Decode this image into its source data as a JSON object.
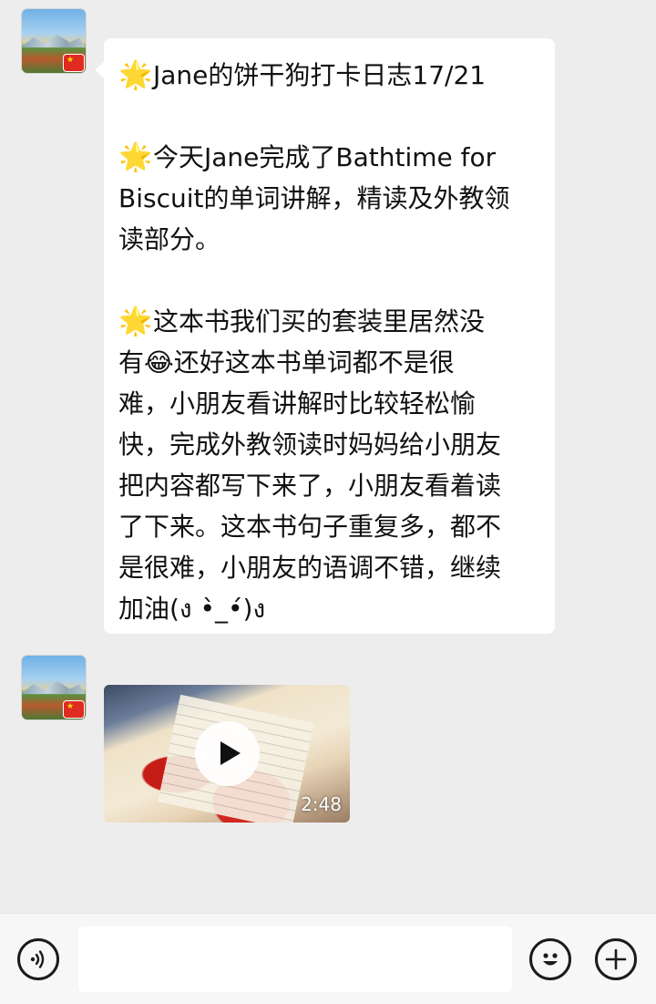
{
  "messages": [
    {
      "type": "text",
      "paragraphs": [
        {
          "icon": "glowing-star-emoji",
          "text": "Jane的饼干狗打卡日志17/21"
        },
        {
          "icon": "glowing-star-emoji",
          "text": "今天Jane完成了Bathtime for\nBiscuit的单词讲解，精读及外教领\n读部分。"
        },
        {
          "icon": "glowing-star-emoji",
          "text_before_emoji": "这本书我们买的套装里居然没\n有",
          "inline_emoji": "😂",
          "text": "还好这本书单词都不是很\n难，小朋友看讲解时比较轻松愉\n快，完成外教领读时妈妈给小朋友\n把内容都写下来了，小朋友看着读\n了下来。这本书句子重复多，都不\n是很难，小朋友的语调不错，继续\n加油(ง •̀_•́)ง"
        }
      ]
    },
    {
      "type": "video",
      "duration": "2:48"
    }
  ],
  "input_bar": {
    "voice_icon": "voice-wave-icon",
    "emoji_icon": "smiley-face-icon",
    "plus_icon": "plus-icon",
    "input_value": ""
  },
  "colors": {
    "background": "#ededed",
    "bubble": "#ffffff",
    "text": "#111111",
    "star": "#f5b400"
  }
}
